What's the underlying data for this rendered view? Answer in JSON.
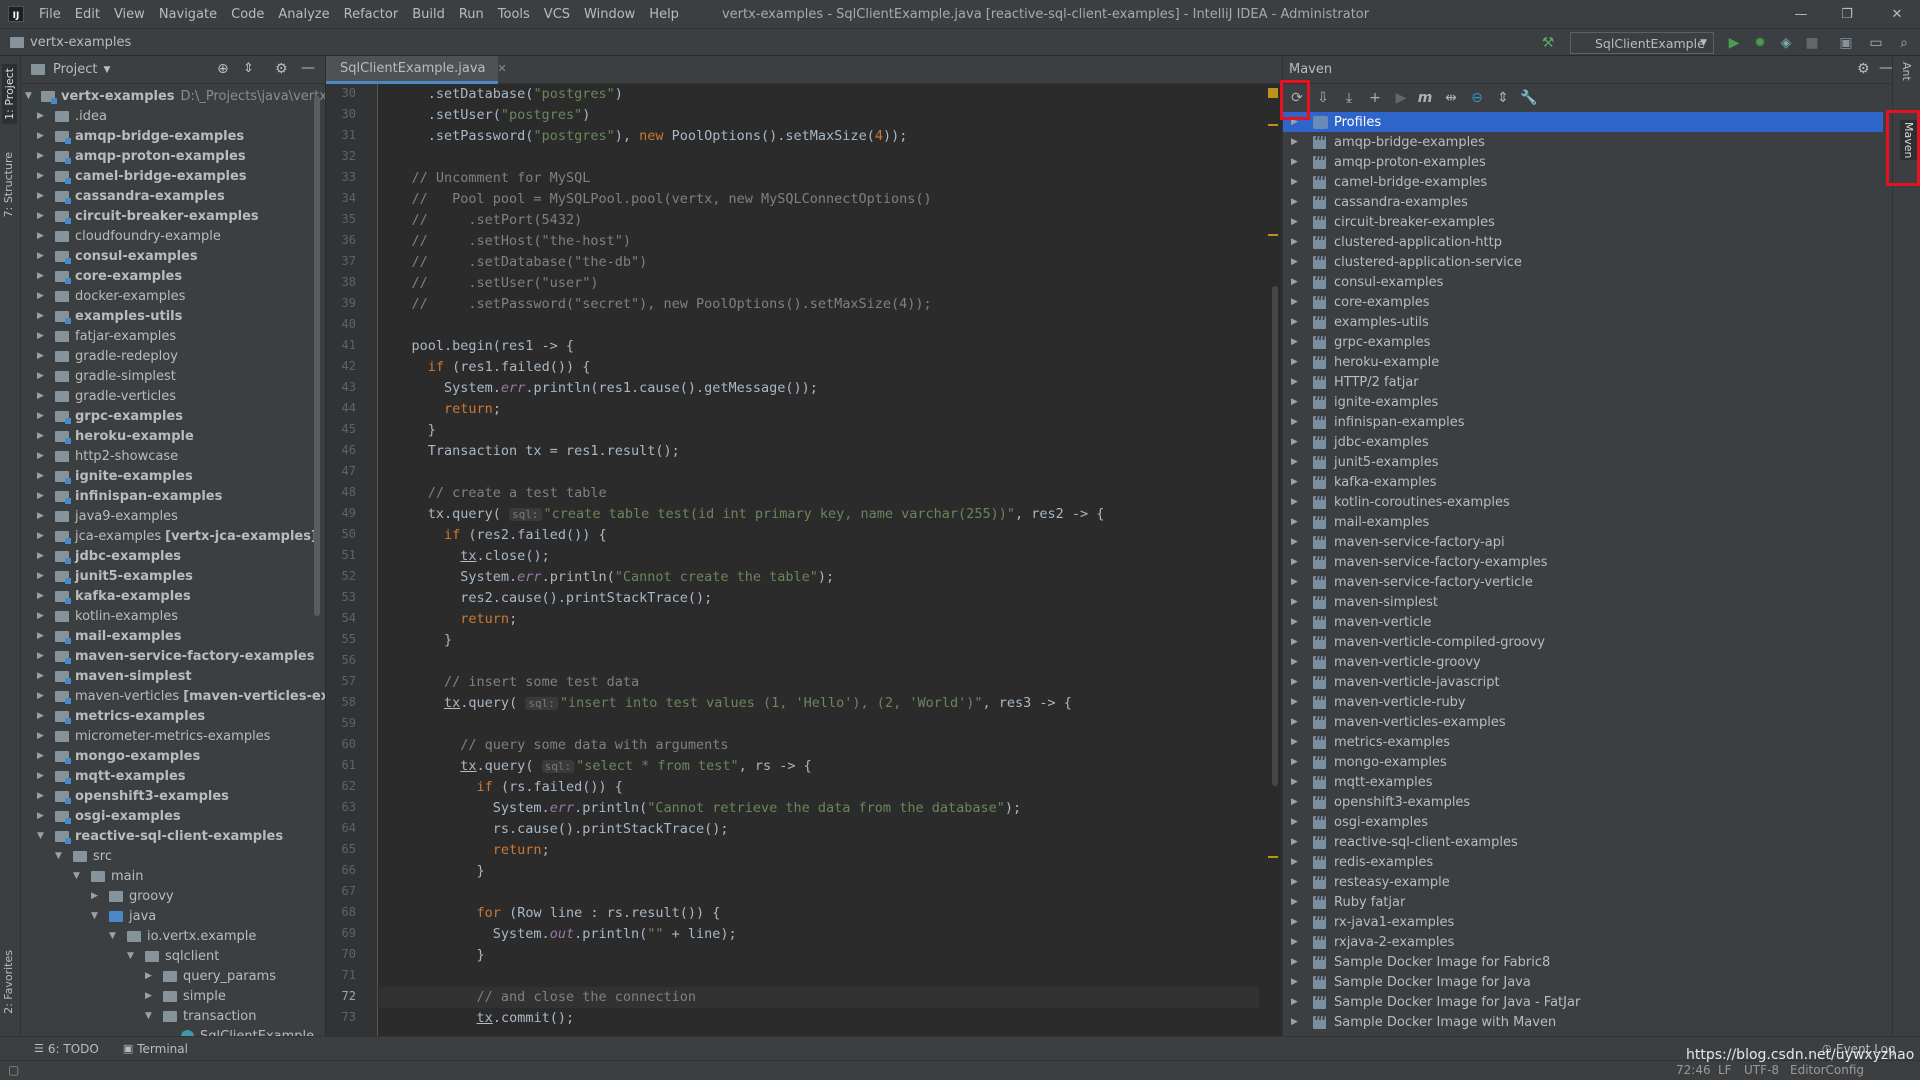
{
  "menubar": {
    "items": [
      "File",
      "Edit",
      "View",
      "Navigate",
      "Code",
      "Analyze",
      "Refactor",
      "Build",
      "Run",
      "Tools",
      "VCS",
      "Window",
      "Help"
    ],
    "title": "vertx-examples - SqlClientExample.java [reactive-sql-client-examples] - IntelliJ IDEA - Administrator"
  },
  "navbar": {
    "crumb": "vertx-examples",
    "run_config": "SqlClientExample"
  },
  "left_strip": {
    "project": "1: Project",
    "structure": "7: Structure",
    "favorites": "2: Favorites"
  },
  "project_panel": {
    "title": "Project",
    "root": {
      "name": "vertx-examples",
      "path": "D:\\_Projects\\java\\vertx-exam"
    },
    "items": [
      {
        "label": ".idea",
        "bold": false
      },
      {
        "label": "amqp-bridge-examples",
        "bold": true
      },
      {
        "label": "amqp-proton-examples",
        "bold": true
      },
      {
        "label": "camel-bridge-examples",
        "bold": true
      },
      {
        "label": "cassandra-examples",
        "bold": true
      },
      {
        "label": "circuit-breaker-examples",
        "bold": true
      },
      {
        "label": "cloudfoundry-example",
        "bold": false
      },
      {
        "label": "consul-examples",
        "bold": true
      },
      {
        "label": "core-examples",
        "bold": true
      },
      {
        "label": "docker-examples",
        "bold": false
      },
      {
        "label": "examples-utils",
        "bold": true
      },
      {
        "label": "fatjar-examples",
        "bold": false
      },
      {
        "label": "gradle-redeploy",
        "bold": false
      },
      {
        "label": "gradle-simplest",
        "bold": false
      },
      {
        "label": "gradle-verticles",
        "bold": false
      },
      {
        "label": "grpc-examples",
        "bold": true
      },
      {
        "label": "heroku-example",
        "bold": true
      },
      {
        "label": "http2-showcase",
        "bold": false
      },
      {
        "label": "ignite-examples",
        "bold": true
      },
      {
        "label": "infinispan-examples",
        "bold": true
      },
      {
        "label": "java9-examples",
        "bold": false
      },
      {
        "label": "jca-examples",
        "bold": false,
        "extra": "[vertx-jca-examples]"
      },
      {
        "label": "jdbc-examples",
        "bold": true
      },
      {
        "label": "junit5-examples",
        "bold": true
      },
      {
        "label": "kafka-examples",
        "bold": true
      },
      {
        "label": "kotlin-examples",
        "bold": false
      },
      {
        "label": "mail-examples",
        "bold": true
      },
      {
        "label": "maven-service-factory-examples",
        "bold": true
      },
      {
        "label": "maven-simplest",
        "bold": true
      },
      {
        "label": "maven-verticles",
        "bold": false,
        "extra": "[maven-verticles-exampl"
      },
      {
        "label": "metrics-examples",
        "bold": true
      },
      {
        "label": "micrometer-metrics-examples",
        "bold": false
      },
      {
        "label": "mongo-examples",
        "bold": true
      },
      {
        "label": "mqtt-examples",
        "bold": true
      },
      {
        "label": "openshift3-examples",
        "bold": true
      },
      {
        "label": "osgi-examples",
        "bold": true
      },
      {
        "label": "reactive-sql-client-examples",
        "bold": true,
        "open": true
      }
    ],
    "nested": [
      {
        "label": "src",
        "depth": 1,
        "open": true
      },
      {
        "label": "main",
        "depth": 2,
        "open": true
      },
      {
        "label": "groovy",
        "depth": 3,
        "open": false
      },
      {
        "label": "java",
        "depth": 3,
        "open": true
      },
      {
        "label": "io.vertx.example",
        "depth": 4,
        "open": true
      },
      {
        "label": "sqlclient",
        "depth": 5,
        "open": true
      },
      {
        "label": "query_params",
        "depth": 6,
        "open": false
      },
      {
        "label": "simple",
        "depth": 6,
        "open": false
      },
      {
        "label": "transaction",
        "depth": 6,
        "open": true
      },
      {
        "label": "SqlClientExample",
        "depth": 7,
        "open": false
      }
    ]
  },
  "editor": {
    "tab": "SqlClientExample.java",
    "current_line": 72,
    "lines": [
      {
        "n": 30,
        "html": "  .setDatabase(<span class='s'>\"postgres\"</span>)"
      },
      {
        "n": 30,
        "html": "  .setUser(<span class='s'>\"postgres\"</span>)"
      },
      {
        "n": 31,
        "html": "  .setPassword(<span class='s'>\"postgres\"</span>), <span class='k'>new</span> PoolOptions().setMaxSize(<span class='k'>4</span>));"
      },
      {
        "n": 32,
        "html": ""
      },
      {
        "n": 33,
        "html": "<span class='c'>// Uncomment for MySQL</span>"
      },
      {
        "n": 34,
        "html": "<span class='c'>//   Pool pool = MySQLPool.pool(vertx, new MySQLConnectOptions()</span>"
      },
      {
        "n": 35,
        "html": "<span class='c'>//     .setPort(5432)</span>"
      },
      {
        "n": 36,
        "html": "<span class='c'>//     .setHost(\"the-host\")</span>"
      },
      {
        "n": 37,
        "html": "<span class='c'>//     .setDatabase(\"the-db\")</span>"
      },
      {
        "n": 38,
        "html": "<span class='c'>//     .setUser(\"user\")</span>"
      },
      {
        "n": 39,
        "html": "<span class='c'>//     .setPassword(\"secret\"), new PoolOptions().setMaxSize(4));</span>"
      },
      {
        "n": 40,
        "html": ""
      },
      {
        "n": 41,
        "html": "pool.begin(res1 -> {"
      },
      {
        "n": 42,
        "html": "  <span class='k'>if</span> (res1.failed()) {"
      },
      {
        "n": 43,
        "html": "    System.<span class='f'>err</span>.println(res1.cause().getMessage());"
      },
      {
        "n": 44,
        "html": "    <span class='k'>return</span>;"
      },
      {
        "n": 45,
        "html": "  }"
      },
      {
        "n": 46,
        "html": "  Transaction tx = res1.result();"
      },
      {
        "n": 47,
        "html": ""
      },
      {
        "n": 48,
        "html": "  <span class='c'>// create a test table</span>"
      },
      {
        "n": 49,
        "html": "  tx.query( <span class='sqlb'>sql:</span><span class='s'>\"create table test(id int primary key, name varchar(255))\"</span>, res2 -> {"
      },
      {
        "n": 50,
        "html": "    <span class='k'>if</span> (res2.failed()) {"
      },
      {
        "n": 51,
        "html": "      <span class='u'>tx</span>.close();"
      },
      {
        "n": 52,
        "html": "      System.<span class='f'>err</span>.println(<span class='s'>\"Cannot create the table\"</span>);"
      },
      {
        "n": 53,
        "html": "      res2.cause().printStackTrace();"
      },
      {
        "n": 54,
        "html": "      <span class='k'>return</span>;"
      },
      {
        "n": 55,
        "html": "    }"
      },
      {
        "n": 56,
        "html": ""
      },
      {
        "n": 57,
        "html": "    <span class='c'>// insert some test data</span>"
      },
      {
        "n": 58,
        "html": "    <span class='u'>tx</span>.query( <span class='sqlb'>sql:</span><span class='s'>\"insert into test values (1, 'Hello'), (2, 'World')\"</span>, res3 -> {"
      },
      {
        "n": 59,
        "html": ""
      },
      {
        "n": 60,
        "html": "      <span class='c'>// query some data with arguments</span>"
      },
      {
        "n": 61,
        "html": "      <span class='u'>tx</span>.query( <span class='sqlb'>sql:</span><span class='s'>\"select * from test\"</span>, rs -> {"
      },
      {
        "n": 62,
        "html": "        <span class='k'>if</span> (rs.failed()) {"
      },
      {
        "n": 63,
        "html": "          System.<span class='f'>err</span>.println(<span class='s'>\"Cannot retrieve the data from the database\"</span>);"
      },
      {
        "n": 64,
        "html": "          rs.cause().printStackTrace();"
      },
      {
        "n": 65,
        "html": "          <span class='k'>return</span>;"
      },
      {
        "n": 66,
        "html": "        }"
      },
      {
        "n": 67,
        "html": ""
      },
      {
        "n": 68,
        "html": "        <span class='k'>for</span> (Row line : rs.result()) {"
      },
      {
        "n": 69,
        "html": "          System.<span class='f'>out</span>.println(<span class='s'>\"\"</span> + line);"
      },
      {
        "n": 70,
        "html": "        }"
      },
      {
        "n": 71,
        "html": ""
      },
      {
        "n": 72,
        "html": "        <span class='c'>// and close the connection</span>"
      },
      {
        "n": 73,
        "html": "        <span class='u'>tx</span>.commit();"
      }
    ]
  },
  "maven_panel": {
    "title": "Maven",
    "items": [
      "Profiles",
      "amqp-bridge-examples",
      "amqp-proton-examples",
      "camel-bridge-examples",
      "cassandra-examples",
      "circuit-breaker-examples",
      "clustered-application-http",
      "clustered-application-service",
      "consul-examples",
      "core-examples",
      "examples-utils",
      "grpc-examples",
      "heroku-example",
      "HTTP/2 fatjar",
      "ignite-examples",
      "infinispan-examples",
      "jdbc-examples",
      "junit5-examples",
      "kafka-examples",
      "kotlin-coroutines-examples",
      "mail-examples",
      "maven-service-factory-api",
      "maven-service-factory-examples",
      "maven-service-factory-verticle",
      "maven-simplest",
      "maven-verticle",
      "maven-verticle-compiled-groovy",
      "maven-verticle-groovy",
      "maven-verticle-javascript",
      "maven-verticle-ruby",
      "maven-verticles-examples",
      "metrics-examples",
      "mongo-examples",
      "mqtt-examples",
      "openshift3-examples",
      "osgi-examples",
      "reactive-sql-client-examples",
      "redis-examples",
      "resteasy-example",
      "Ruby fatjar",
      "rx-java1-examples",
      "rxjava-2-examples",
      "Sample Docker Image for Fabric8",
      "Sample Docker Image for Java",
      "Sample Docker Image for Java - FatJar",
      "Sample Docker Image with Maven"
    ]
  },
  "right_strip": {
    "ant": "Ant",
    "maven": "Maven"
  },
  "bottom": {
    "todo": "6: TODO",
    "terminal": "Terminal",
    "event_log": "Event Log"
  },
  "status": {
    "position": "72:46",
    "line_sep": "LF",
    "encoding": "UTF-8",
    "editorconfig": "EditorConfig",
    "watermark": "https://blog.csdn.net/uywxyzhao"
  },
  "colors": {
    "highlight": "#e81123",
    "selection": "#2f65ca",
    "accent": "#4a88c7"
  }
}
